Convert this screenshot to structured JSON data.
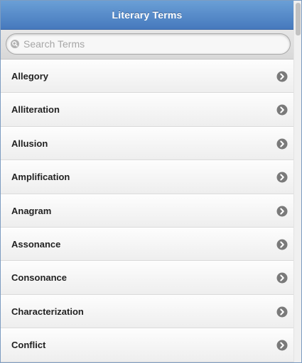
{
  "header": {
    "title": "Literary Terms"
  },
  "search": {
    "placeholder": "Search Terms",
    "value": ""
  },
  "terms": [
    {
      "label": "Allegory"
    },
    {
      "label": "Alliteration"
    },
    {
      "label": "Allusion"
    },
    {
      "label": "Amplification"
    },
    {
      "label": "Anagram"
    },
    {
      "label": "Assonance"
    },
    {
      "label": "Consonance"
    },
    {
      "label": "Characterization"
    },
    {
      "label": "Conflict"
    }
  ],
  "icons": {
    "search": "search-icon",
    "item_arrow": "chevron-right-circle-icon"
  },
  "colors": {
    "header_top": "#6a9fd6",
    "header_bottom": "#4679bd",
    "arrow_circle": "#7a7a7a"
  }
}
